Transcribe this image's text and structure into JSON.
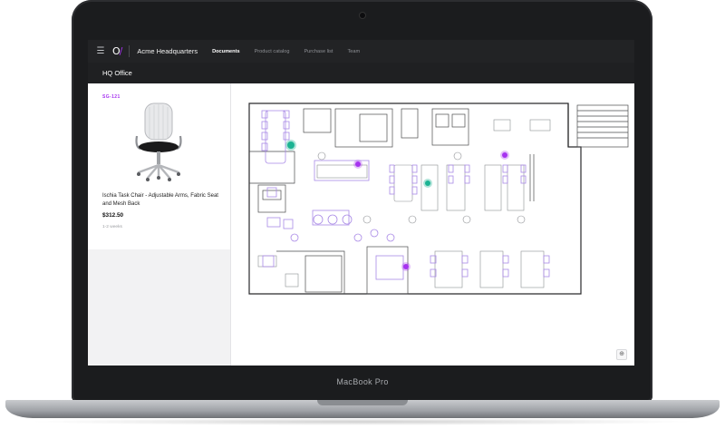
{
  "device": {
    "label": "MacBook Pro"
  },
  "nav": {
    "logo_text": "O/",
    "org_name": "Acme Headquarters",
    "tabs": [
      {
        "label": "Documents",
        "active": true
      },
      {
        "label": "Product catalog",
        "active": false
      },
      {
        "label": "Purchase list",
        "active": false
      },
      {
        "label": "Team",
        "active": false
      }
    ]
  },
  "page": {
    "title": "HQ Office"
  },
  "product": {
    "sku": "SG-121",
    "name": "Ischia Task Chair - Adjustable Arms, Fabric Seat and Mesh Back",
    "price": "$312.50",
    "lead_time": "1-2 weeks"
  },
  "map": {
    "marker_colors": {
      "purple": "#a633f0",
      "teal": "#1cb393"
    },
    "accent_furniture": "#a989e6",
    "zoom_icon": "zoom-in-icon"
  }
}
